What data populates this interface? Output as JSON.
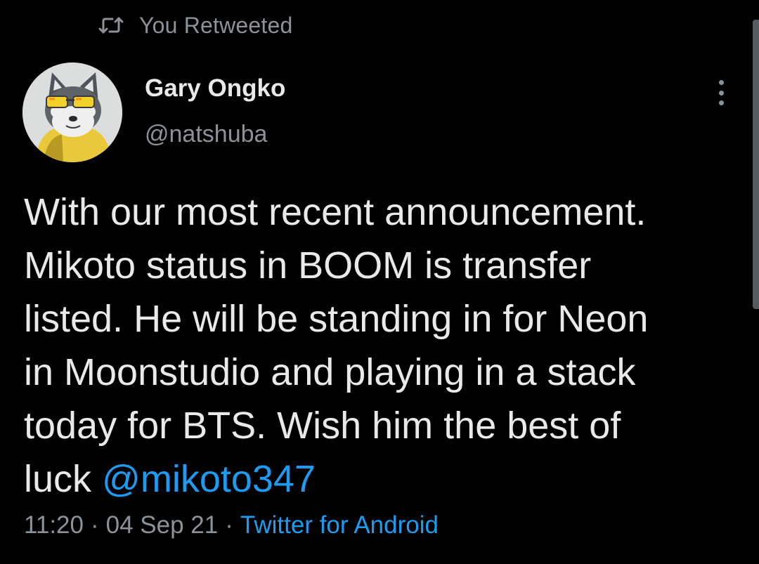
{
  "retweet": {
    "label": "You Retweeted",
    "icon": "retweet-icon"
  },
  "author": {
    "name": "Gary Ongko",
    "handle": "@natshuba",
    "avatar_icon": "shiba-dog-with-sunglasses-avatar"
  },
  "more_icon": "vertical-ellipsis-icon",
  "tweet": {
    "text": "With our most recent announcement.\nMikoto status in BOOM is transfer\nlisted. He will be standing in for Neon\nin Moonstudio and playing in a stack\ntoday for BTS. Wish him the best of\nluck ",
    "mention": "@mikoto347"
  },
  "meta": {
    "time": "11:20",
    "separator": "·",
    "date": "04 Sep 21",
    "source": "Twitter for Android"
  },
  "colors": {
    "background": "#000000",
    "primary_text": "#e7e9ea",
    "secondary_text": "#8b9399",
    "link": "#1d9bf0"
  }
}
